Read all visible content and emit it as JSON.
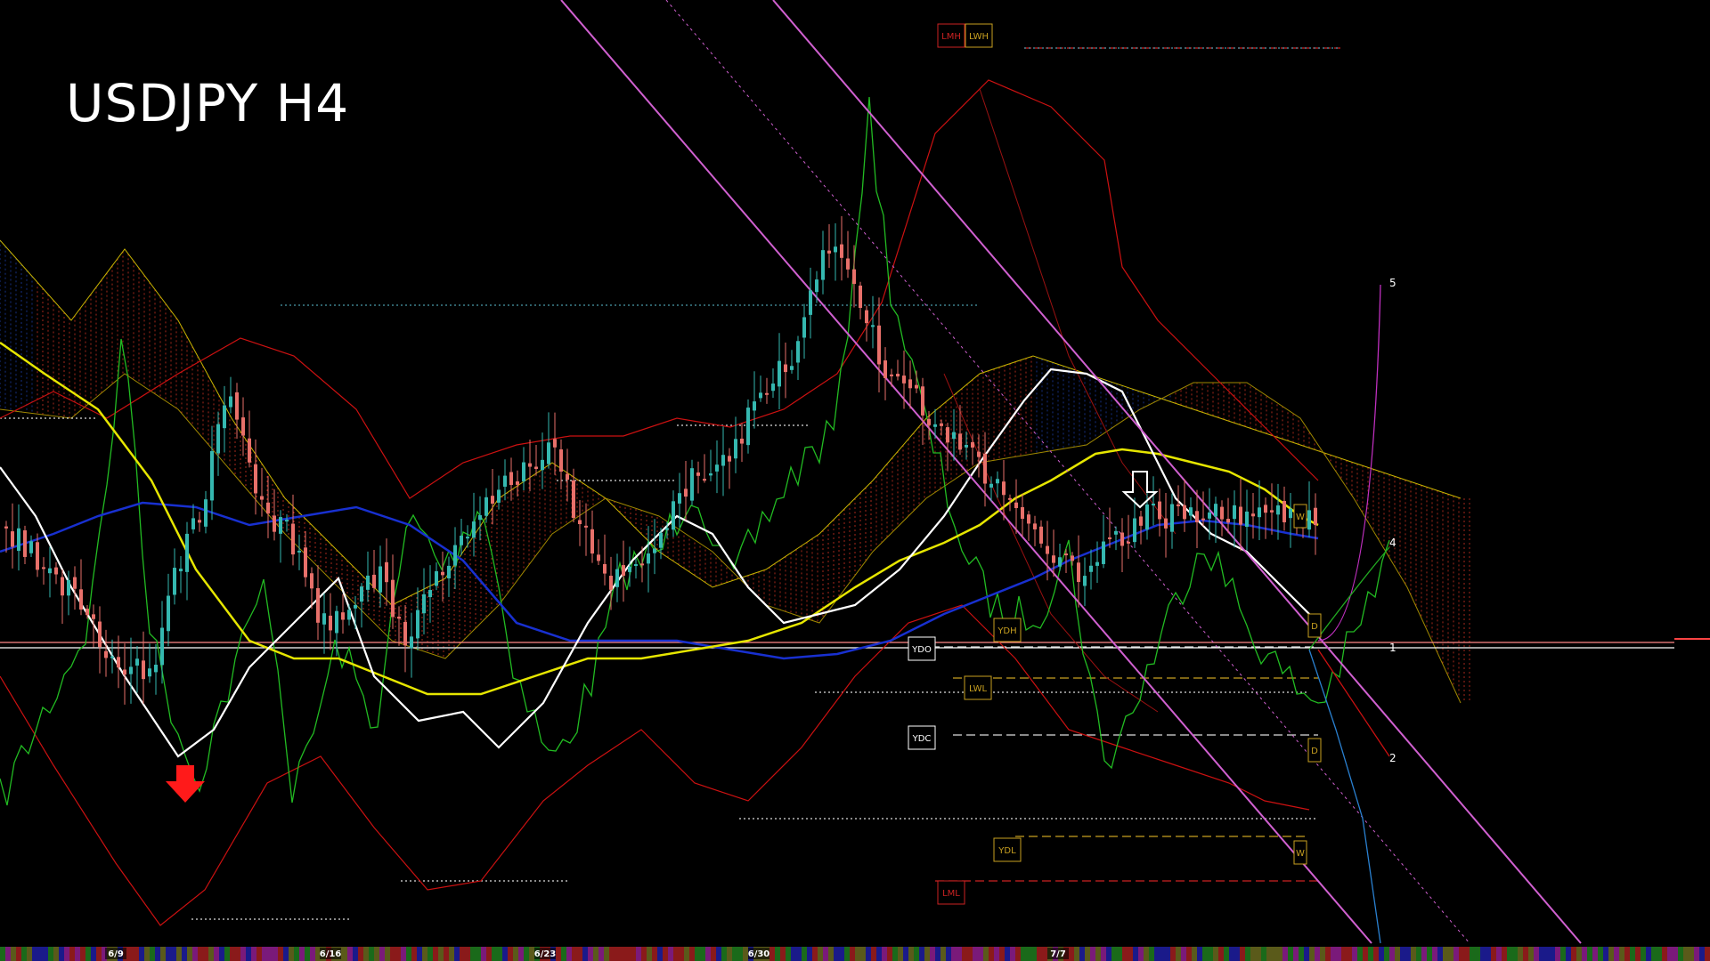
{
  "window": {
    "title": "USDJPY H4"
  },
  "colors": {
    "background": "#000000",
    "bull_candle": "#35b8b0",
    "bear_candle": "#e8706a",
    "ma_white": "#ffffff",
    "ma_yellow": "#e6e600",
    "ma_blue": "#1830d0",
    "oscillator": "#22bb22",
    "bollinger": "#cc1111",
    "channel": "#d060d0",
    "cloud_bear": "#c03020",
    "cloud_bull": "#1a3a9a"
  },
  "icons": {
    "sell_signal": "red-down-arrow-icon",
    "down_signal": "white-outline-down-arrow-icon"
  },
  "chart_data": {
    "type": "candlestick",
    "title": "USDJPY H4",
    "x_tick_labels": [
      "6/9",
      "6/16",
      "6/23",
      "6/30",
      "7/7"
    ],
    "levels": [
      {
        "label": "LMH",
        "color": "#cc2222"
      },
      {
        "label": "LWH",
        "color": "#c8a020"
      },
      {
        "label": "YDH",
        "color": "#c8a020"
      },
      {
        "label": "YDO",
        "color": "#ffffff"
      },
      {
        "label": "LWL",
        "color": "#c8a020"
      },
      {
        "label": "YDC",
        "color": "#ffffff"
      },
      {
        "label": "YDL",
        "color": "#c8a020"
      },
      {
        "label": "LML",
        "color": "#cc2222"
      },
      {
        "label": "W",
        "color": "#c8a020"
      },
      {
        "label": "D",
        "color": "#c8a020"
      }
    ],
    "wave_labels": [
      "1",
      "2",
      "4",
      "5"
    ],
    "grid": false,
    "legend": "none"
  }
}
